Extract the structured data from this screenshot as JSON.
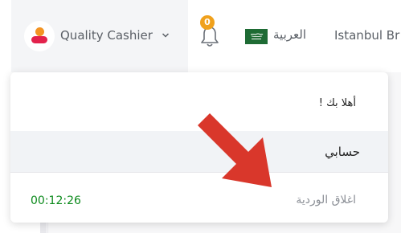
{
  "header": {
    "user_name": "Quality Cashier",
    "notifications_count": "0",
    "language_label": "العربية",
    "branch_label": "Istanbul Br"
  },
  "dropdown": {
    "welcome_text": "أهلا بك !",
    "account_label": "حسابي",
    "close_shift_label": "اغلاق الوردية",
    "shift_timer": "00:12:26"
  },
  "icons": {
    "logo": "app-logo-icon",
    "chevron": "chevron-down-icon",
    "bell": "bell-icon",
    "flag": "saudi-flag-icon",
    "annotation": "red-arrow-icon"
  },
  "colors": {
    "badge": "#f0a11c",
    "timer": "#0c8a1c",
    "arrow": "#d9372b",
    "flag": "#1e6b34"
  }
}
